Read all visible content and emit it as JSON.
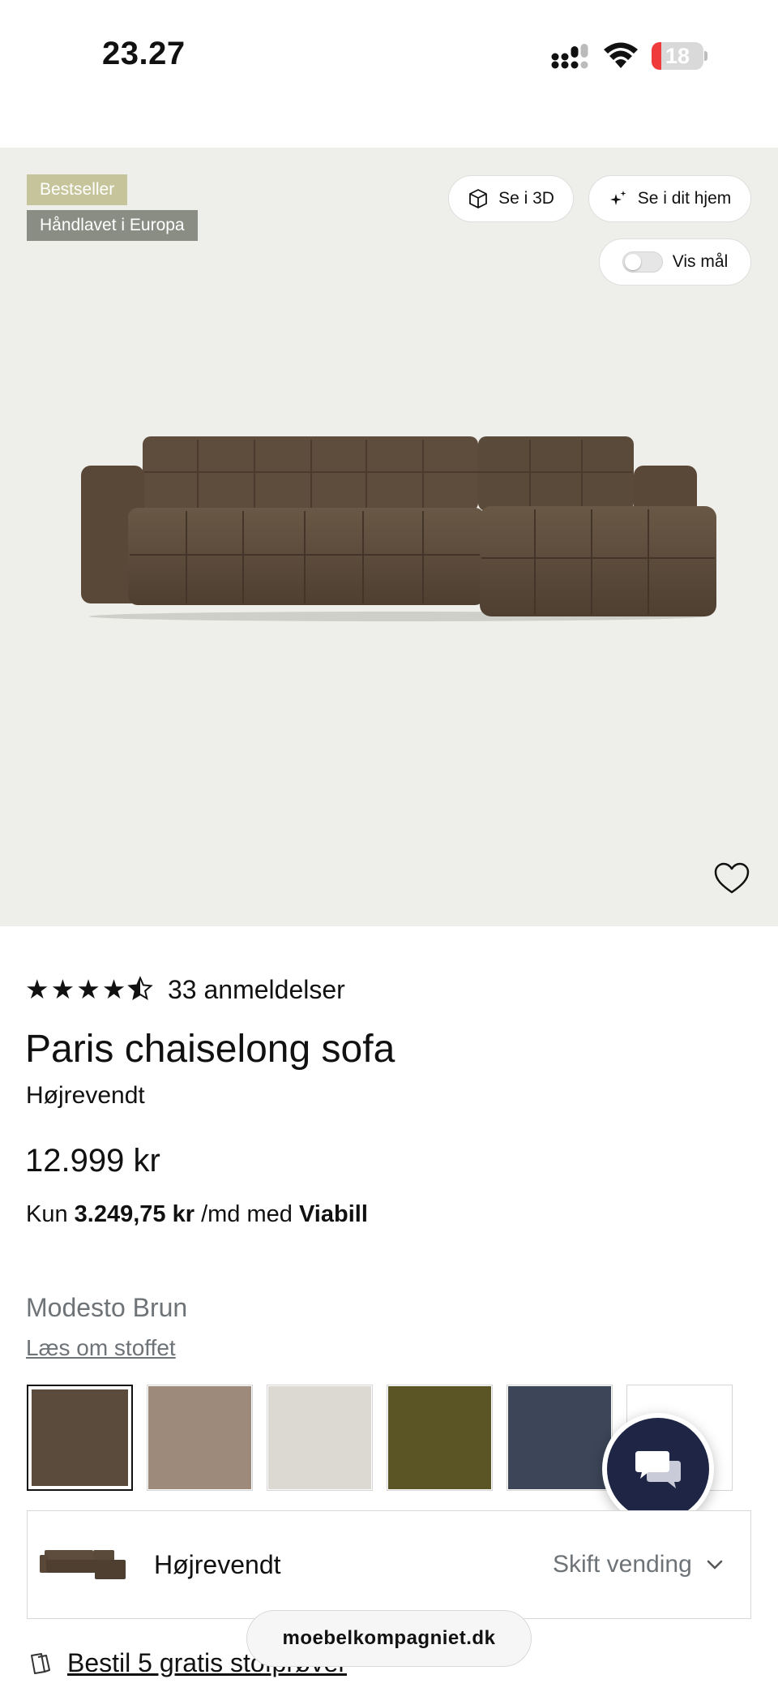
{
  "status_bar": {
    "time": "23.27",
    "battery_level": "18",
    "battery_fraction": 0.18
  },
  "hero": {
    "badges": [
      "Bestseller",
      "Håndlavet i Europa"
    ],
    "buttons": {
      "view_3d": "Se i 3D",
      "view_home": "Se i dit hjem",
      "show_dimensions": "Vis mål"
    },
    "dimensions_toggle_on": false,
    "favorite_icon": "heart-outline-icon"
  },
  "product": {
    "rating": 4.5,
    "reviews": "33 anmeldelser",
    "title": "Paris chaiselong sofa",
    "subtitle": "Højrevendt",
    "price": "12.999 kr",
    "financing": {
      "prefix": "Kun",
      "amount": "3.249,75 kr",
      "middle": "/md med",
      "provider": "Viabill"
    }
  },
  "fabric": {
    "color_name": "Modesto Brun",
    "read_more": "Læs om stoffet",
    "swatches": [
      {
        "color": "#5b4b3c",
        "selected": true
      },
      {
        "color": "#9d8a7b",
        "selected": false
      },
      {
        "color": "#dcd8d2",
        "selected": false
      },
      {
        "color": "#5b5526",
        "selected": false
      },
      {
        "color": "#3c4658",
        "selected": false
      },
      {
        "color": "#ffffff",
        "selected": false
      }
    ]
  },
  "orientation": {
    "label": "Højrevendt",
    "switch": "Skift vending"
  },
  "samples": {
    "link": "Bestil 5 gratis stofprøver"
  },
  "browser": {
    "url": "moebelkompagniet.dk"
  },
  "colors": {
    "sofa": "#5e4d3d",
    "hero_bg": "#eeeeea",
    "chat_bg": "#1f2545",
    "badge_bestseller": "#c6c49b",
    "badge_handmade": "#8a8d83"
  }
}
